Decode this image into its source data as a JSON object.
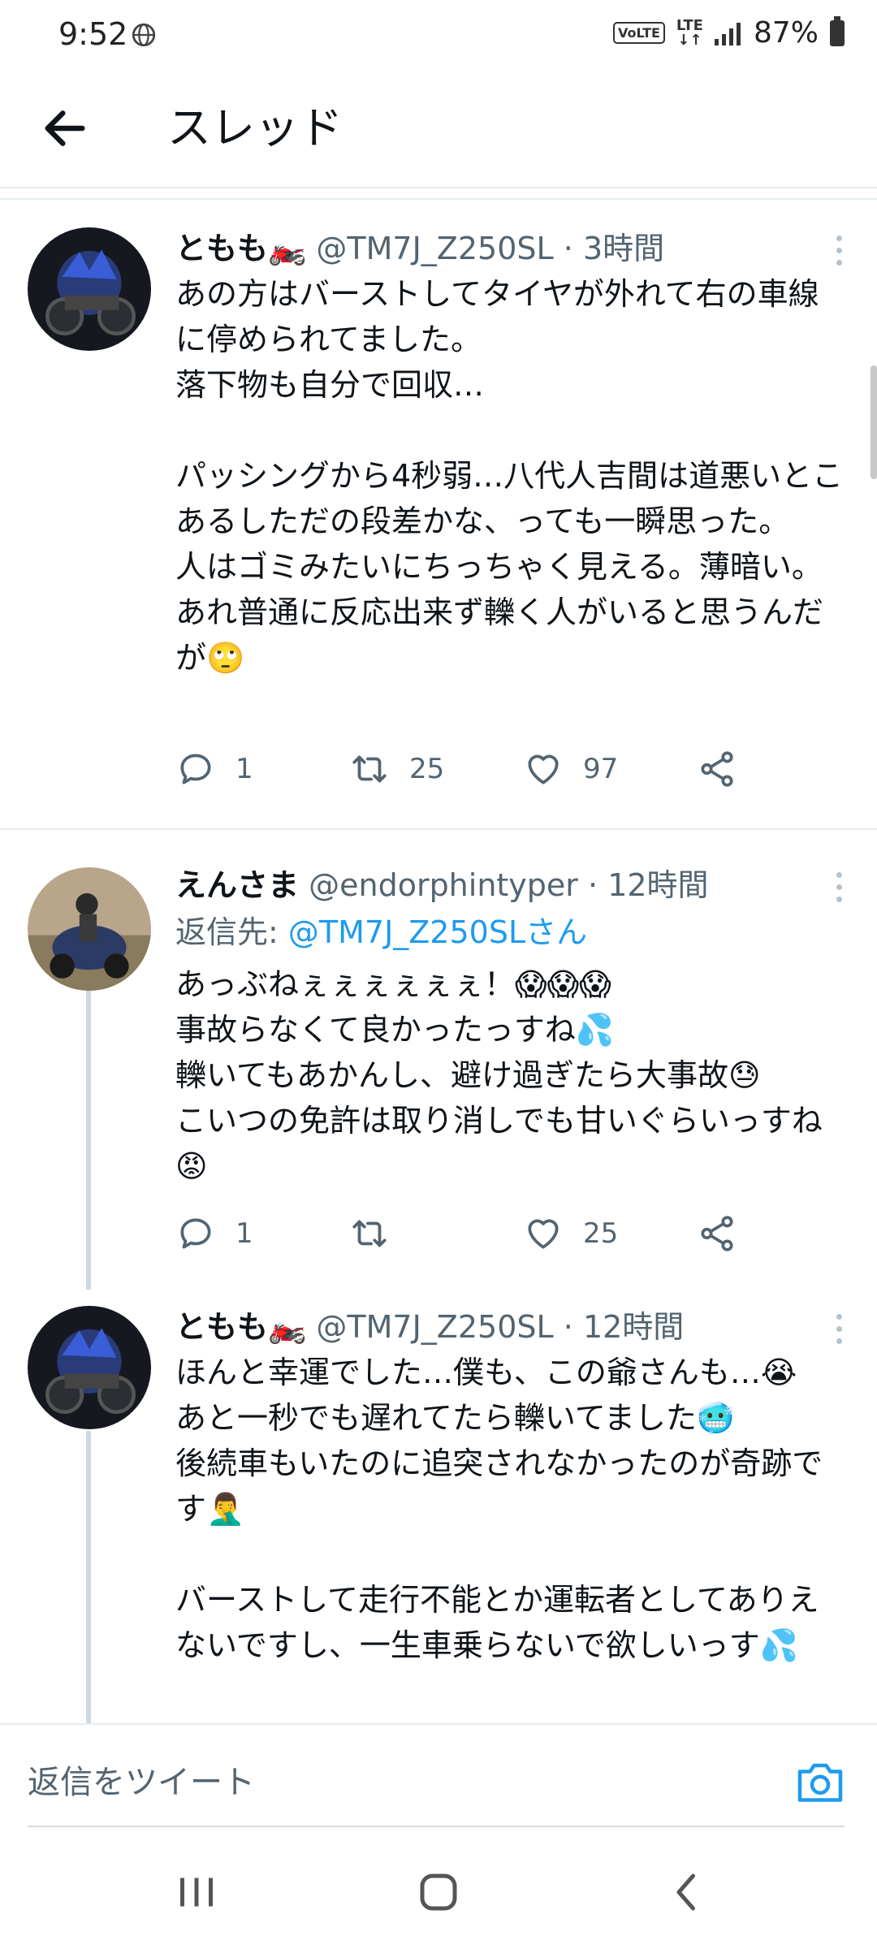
{
  "status_bar": {
    "time": "9:52",
    "network_badge": "VoLTE",
    "lte_label": "LTE",
    "battery": "87%"
  },
  "header": {
    "title": "スレッド"
  },
  "tweets": [
    {
      "name": "ともも🏍️",
      "handle": "@TM7J_Z250SL",
      "time": "3時間",
      "text": "あの方はバーストしてタイヤが外れて右の車線に停められてました。\n落下物も自分で回収…\n\nパッシングから4秒弱…八代人吉間は道悪いとこあるしただの段差かな、っても一瞬思った。\n人はゴミみたいにちっちゃく見える。薄暗い。あれ普通に反応出来ず轢く人がいると思うんだが🙄",
      "replies": "1",
      "retweets": "25",
      "likes": "97"
    },
    {
      "name": "えんさま",
      "handle": "@endorphintyper",
      "time": "12時間",
      "reply_prefix": "返信先: ",
      "reply_to": "@TM7J_Z250SLさん",
      "text": "あっぶねぇぇぇぇぇぇ！😱😱😱\n事故らなくて良かったっすね💦\n轢いてもあかんし、避け過ぎたら大事故😓\nこいつの免許は取り消しでも甘いぐらいっすね😡",
      "replies": "1",
      "retweets": "",
      "likes": "25"
    },
    {
      "name": "ともも🏍️",
      "handle": "@TM7J_Z250SL",
      "time": "12時間",
      "text": "ほんと幸運でした…僕も、この爺さんも…😭\nあと一秒でも遅れてたら轢いてました🥶\n後続車もいたのに追突されなかったのが奇跡です🤦‍♂️\n\nバーストして走行不能とか運転者としてありえないですし、一生車乗らないで欲しいっす💦"
    }
  ],
  "reply_bar": {
    "placeholder": "返信をツイート"
  },
  "colors": {
    "accent": "#1d9bf0",
    "text": "#0f1419",
    "secondary": "#536471",
    "divider": "#e6ecf0"
  }
}
